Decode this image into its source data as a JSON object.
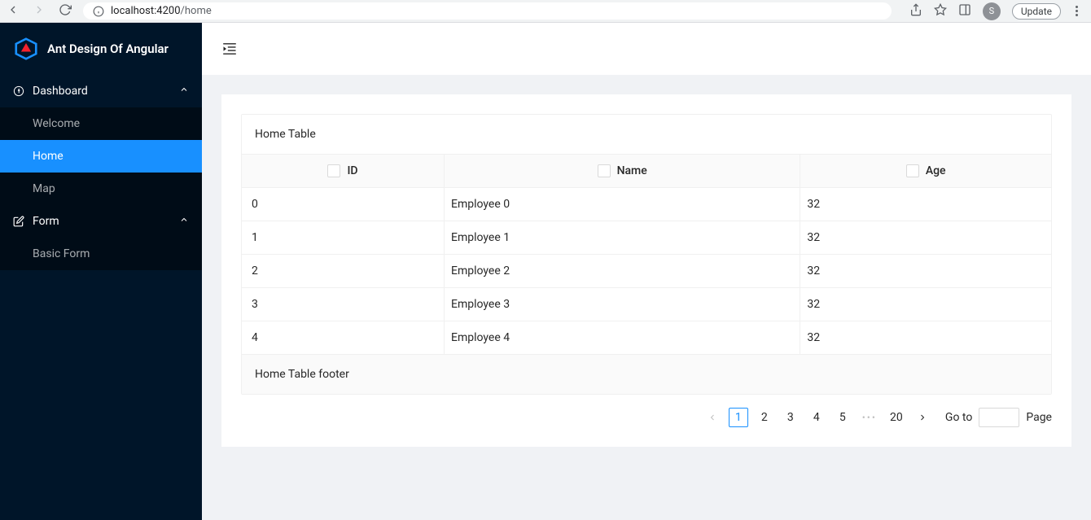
{
  "browser": {
    "url_host": "localhost:4200",
    "url_path": "/home",
    "avatar_initial": "S",
    "update_label": "Update"
  },
  "sidebar": {
    "logo_text": "Ant Design Of Angular",
    "groups": [
      {
        "label": "Dashboard",
        "icon": "dashboard-icon",
        "expanded": true,
        "items": [
          {
            "label": "Welcome",
            "active": false
          },
          {
            "label": "Home",
            "active": true
          },
          {
            "label": "Map",
            "active": false
          }
        ]
      },
      {
        "label": "Form",
        "icon": "form-icon",
        "expanded": true,
        "items": [
          {
            "label": "Basic Form",
            "active": false
          }
        ]
      }
    ]
  },
  "table": {
    "title": "Home Table",
    "footer": "Home Table footer",
    "columns": [
      {
        "label": "ID"
      },
      {
        "label": "Name"
      },
      {
        "label": "Age"
      }
    ],
    "rows": [
      {
        "id": "0",
        "name": "Employee 0",
        "age": "32"
      },
      {
        "id": "1",
        "name": "Employee 1",
        "age": "32"
      },
      {
        "id": "2",
        "name": "Employee 2",
        "age": "32"
      },
      {
        "id": "3",
        "name": "Employee 3",
        "age": "32"
      },
      {
        "id": "4",
        "name": "Employee 4",
        "age": "32"
      }
    ]
  },
  "pagination": {
    "pages_visible": [
      "1",
      "2",
      "3",
      "4",
      "5"
    ],
    "last_page": "20",
    "active": "1",
    "goto_label": "Go to",
    "page_label": "Page"
  }
}
